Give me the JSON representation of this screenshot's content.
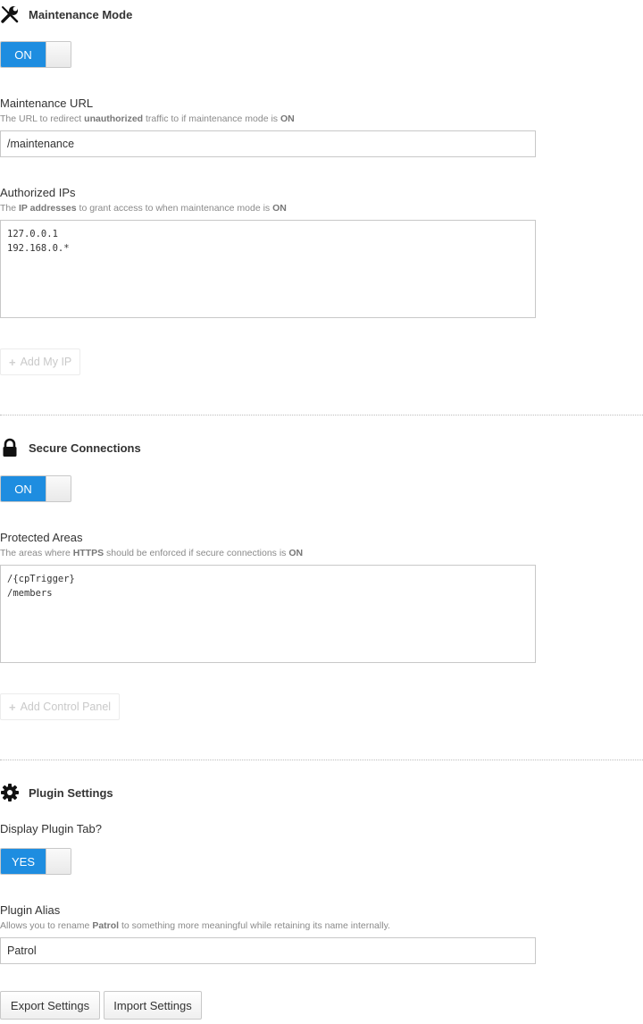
{
  "maintenance": {
    "title": "Maintenance Mode",
    "toggle_label": "ON",
    "url_label": "Maintenance URL",
    "url_help_1": "The URL to redirect ",
    "url_help_2": "unauthorized",
    "url_help_3": " traffic to if maintenance mode is ",
    "url_help_4": "ON",
    "url_value": "/maintenance",
    "ips_label": "Authorized IPs",
    "ips_help_1": "The ",
    "ips_help_2": "IP addresses",
    "ips_help_3": " to grant access to when maintenance mode is ",
    "ips_help_4": "ON",
    "ips_value": "127.0.0.1\n192.168.0.*",
    "add_ip_label": "Add My IP"
  },
  "secure": {
    "title": "Secure Connections",
    "toggle_label": "ON",
    "areas_label": "Protected Areas",
    "areas_help_1": "The areas where ",
    "areas_help_2": "HTTPS",
    "areas_help_3": " should be enforced if secure connections is ",
    "areas_help_4": "ON",
    "areas_value": "/{cpTrigger}\n/members",
    "add_cp_label": "Add Control Panel"
  },
  "plugin": {
    "title": "Plugin Settings",
    "tab_label": "Display Plugin Tab?",
    "toggle_label": "YES",
    "alias_label": "Plugin Alias",
    "alias_help_1": "Allows you to rename ",
    "alias_help_2": "Patrol",
    "alias_help_3": " to something more meaningful while retaining its name internally.",
    "alias_value": "Patrol"
  },
  "actions": {
    "export_label": "Export Settings",
    "import_label": "Import Settings"
  },
  "icons": {
    "maintenance": "wrench-screwdriver-icon",
    "secure": "lock-icon",
    "plugin": "gear-icon",
    "add": "plus-icon"
  },
  "colors": {
    "toggle_on": "#1e8de0"
  }
}
